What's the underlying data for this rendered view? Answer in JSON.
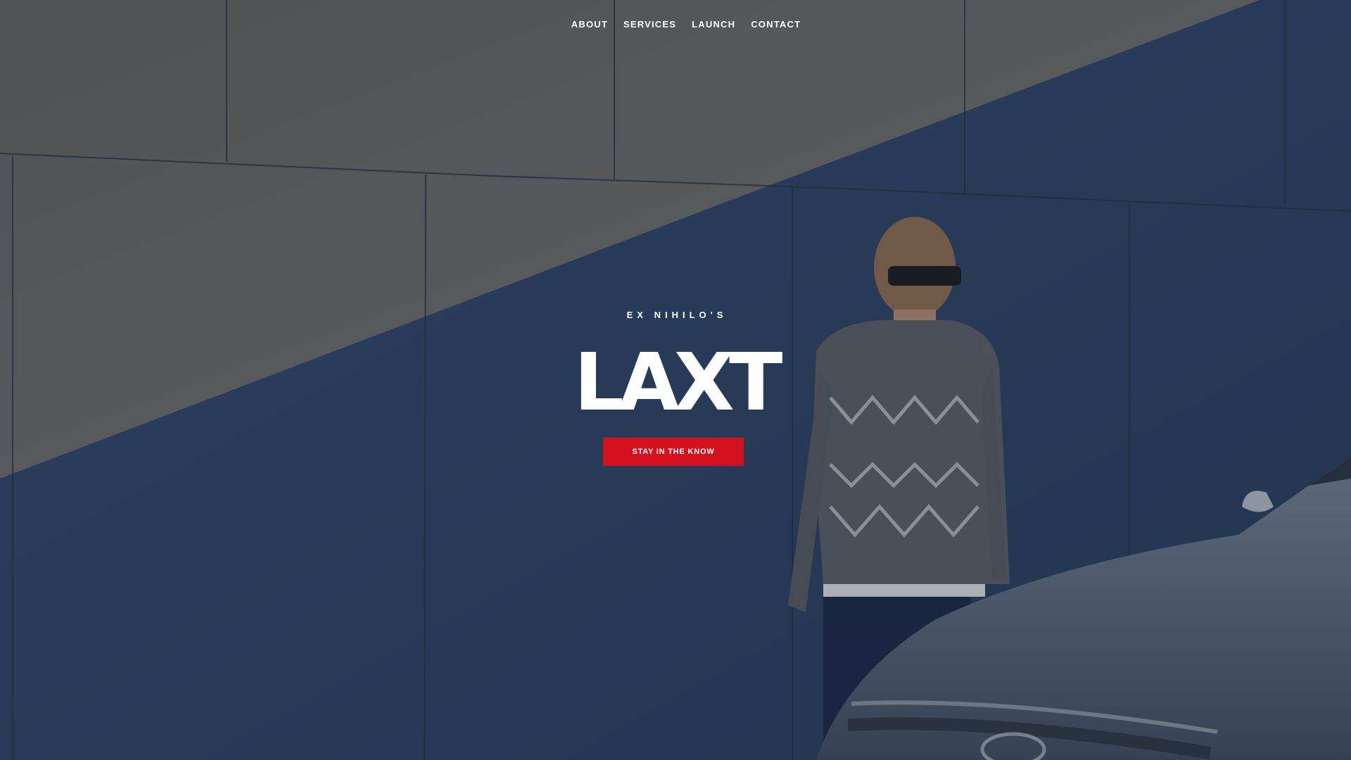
{
  "nav": {
    "items": [
      {
        "label": "ABOUT"
      },
      {
        "label": "SERVICES"
      },
      {
        "label": "LAUNCH"
      },
      {
        "label": "CONTACT"
      }
    ]
  },
  "hero": {
    "eyebrow": "EX NIHILO'S",
    "title": "LAXT",
    "cta_label": "STAY IN THE KNOW"
  },
  "colors": {
    "accent": "#d6111e",
    "wall_sunlit": "#6b6b66",
    "wall_shadow": "#2f4566",
    "text": "#ffffff"
  }
}
